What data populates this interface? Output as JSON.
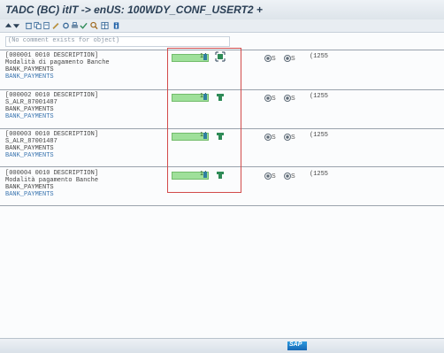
{
  "window": {
    "title": "TADC (BC) itIT -> enUS: 100WDY_CONF_USERT2 +"
  },
  "toolbar": {
    "icons": [
      "arrow-up-icon",
      "arrow-down-icon",
      "delete-icon",
      "copy-icon",
      "document-icon",
      "edit-icon",
      "settings-icon",
      "print-icon",
      "check-icon",
      "find-icon",
      "table-icon",
      "info-icon"
    ]
  },
  "comment_hint": "(No comment exists for object)",
  "entries": [
    {
      "header": "[000001 0010 DESCRIPTION]",
      "line2": "Modalità di pagamento Banche",
      "line3": "BANK_PAYMENTS",
      "line4": "BANK_PAYMENTS",
      "count": "14",
      "radio1": "S",
      "radio2": "S",
      "length": "(1255"
    },
    {
      "header": "[000002 0010 DESCRIPTION]",
      "line2": "S_ALR_87001487",
      "line3": "BANK_PAYMENTS",
      "line4": "BANK_PAYMENTS",
      "count": "14",
      "radio1": "S",
      "radio2": "S",
      "length": "(1255"
    },
    {
      "header": "[000003 0010 DESCRIPTION]",
      "line2": "S_ALR_87001487",
      "line3": "BANK_PAYMENTS",
      "line4": "BANK_PAYMENTS",
      "count": "14",
      "radio1": "S",
      "radio2": "S",
      "length": "(1255"
    },
    {
      "header": "[000004 0010 DESCRIPTION]",
      "line2": "Modalità pagamento Banche",
      "line3": "BANK_PAYMENTS",
      "line4": "BANK_PAYMENTS",
      "count": "14",
      "radio1": "S",
      "radio2": "S",
      "length": "(1255"
    }
  ],
  "status": {
    "logo": "SAP"
  },
  "colors": {
    "highlight_box": "#d24b4b",
    "bar_fill": "#9fe09a",
    "link_text": "#3a75b0"
  }
}
